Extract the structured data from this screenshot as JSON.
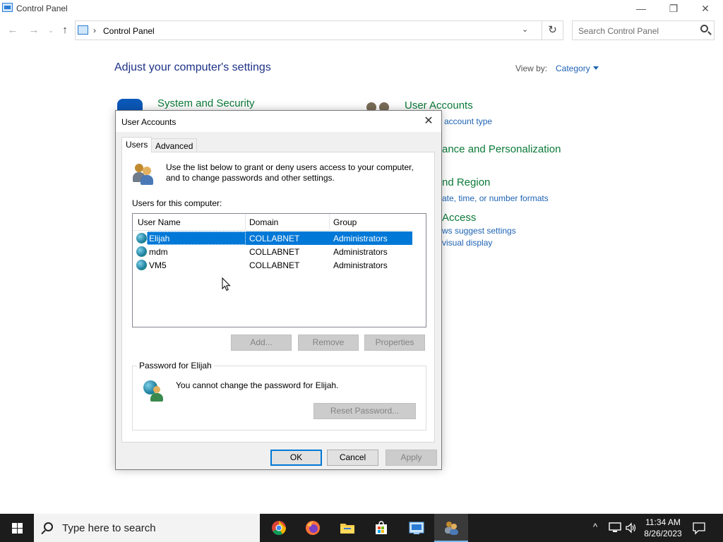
{
  "window": {
    "title": "Control Panel",
    "minimize_glyph": "—",
    "restore_glyph": "❐",
    "close_glyph": "✕"
  },
  "nav": {
    "back_glyph": "←",
    "forward_glyph": "→",
    "recent_glyph": "⌄",
    "up_glyph": "↑"
  },
  "address": {
    "separator": "›",
    "breadcrumb": "Control Panel",
    "dropdown_glyph": "⌄",
    "refresh_glyph": "↻"
  },
  "search": {
    "placeholder": "Search Control Panel"
  },
  "main": {
    "heading": "Adjust your computer's settings",
    "view_by_label": "View by:",
    "view_by_value": "Category",
    "categories": [
      {
        "title": "System and Security",
        "links": []
      },
      {
        "title": "User Accounts",
        "links": [
          "Change account type"
        ]
      },
      {
        "title": "Appearance and Personalization",
        "links": []
      },
      {
        "title": "Clock and Region",
        "links": [
          "Change date, time, or number formats"
        ]
      },
      {
        "title": "Ease of Access",
        "links": [
          "Let Windows suggest settings",
          "Optimize visual display"
        ]
      }
    ],
    "visible_fragments": {
      "ua_link": "e account type",
      "appearance": "ance and Personalization",
      "region": "nd Region",
      "region_link": "ate, time, or number formats",
      "access": "Access",
      "access_link1": "ws suggest settings",
      "access_link2": "visual display"
    }
  },
  "dialog": {
    "title": "User Accounts",
    "close_glyph": "✕",
    "tabs": [
      {
        "label": "Users",
        "active": true
      },
      {
        "label": "Advanced",
        "active": false
      }
    ],
    "intro_text": "Use the list below to grant or deny users access to your computer, and to change passwords and other settings.",
    "users_label": "Users for this computer:",
    "columns": [
      "User Name",
      "Domain",
      "Group"
    ],
    "users": [
      {
        "name": "Elijah",
        "domain": "COLLABNET",
        "group": "Administrators",
        "selected": true
      },
      {
        "name": "mdm",
        "domain": "COLLABNET",
        "group": "Administrators",
        "selected": false
      },
      {
        "name": "VM5",
        "domain": "COLLABNET",
        "group": "Administrators",
        "selected": false
      }
    ],
    "buttons": {
      "add": "Add...",
      "remove": "Remove",
      "properties": "Properties",
      "reset_password": "Reset Password...",
      "ok": "OK",
      "cancel": "Cancel",
      "apply": "Apply"
    },
    "password_group": {
      "label": "Password for Elijah",
      "message": "You cannot change the password for Elijah."
    }
  },
  "taskbar": {
    "search_placeholder": "Type here to search",
    "apps": [
      "chrome-icon",
      "firefox-icon",
      "file-explorer-icon",
      "store-icon",
      "control-panel-icon",
      "user-accounts-icon"
    ],
    "time": "11:34 AM",
    "date": "8/26/2023",
    "tray_chevron": "^"
  },
  "colors": {
    "link_blue": "#1e63b4",
    "heading_navy": "#1e3287",
    "category_green": "#0b7a38",
    "selection_blue": "#0078d7",
    "taskbar": "#1c1c1c"
  }
}
